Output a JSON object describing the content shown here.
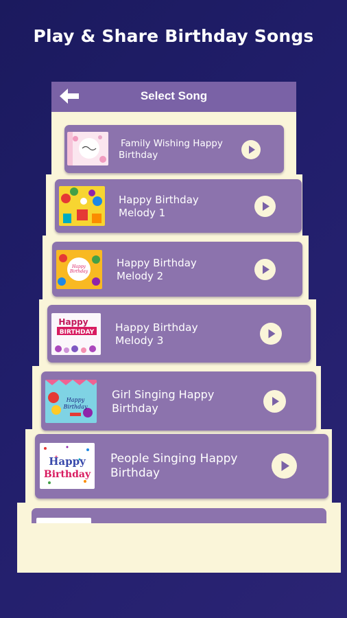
{
  "headline": "Play & Share Birthday Songs",
  "app_bar": {
    "title": "Select Song",
    "back_icon": "back-arrow-icon"
  },
  "colors": {
    "background": "#1e1c62",
    "app_bar": "#7a62a6",
    "card": "#8c73ad",
    "panel": "#faf5d9",
    "play_button": "#faf5d9",
    "play_icon": "#7a62a6"
  },
  "songs": [
    {
      "title": "Family Wishing Happy Birthday",
      "line1": "Family Wishing Happy",
      "line2": "Birthday",
      "thumb_text": "",
      "play_icon": "play-icon"
    },
    {
      "title": "Happy Birthday Melody 1",
      "line1": "Happy Birthday",
      "line2": "Melody 1",
      "thumb_text": "",
      "play_icon": "play-icon"
    },
    {
      "title": "Happy Birthday Melody 2",
      "line1": "Happy Birthday",
      "line2": "Melody 2",
      "thumb_text": "Happy Birthday",
      "play_icon": "play-icon"
    },
    {
      "title": "Happy Birthday Melody 3",
      "line1": "Happy Birthday",
      "line2": "Melody 3",
      "thumb_text": "Happy BIRTHDAY",
      "play_icon": "play-icon"
    },
    {
      "title": "Girl Singing Happy Birthday",
      "line1": "Girl Singing Happy",
      "line2": "Birthday",
      "thumb_text": "Happy Birthday",
      "play_icon": "play-icon"
    },
    {
      "title": "People Singing Happy Birthday",
      "line1": "People Singing Happy",
      "line2": "Birthday",
      "thumb_text": "Happy Birthday",
      "play_icon": "play-icon"
    }
  ]
}
